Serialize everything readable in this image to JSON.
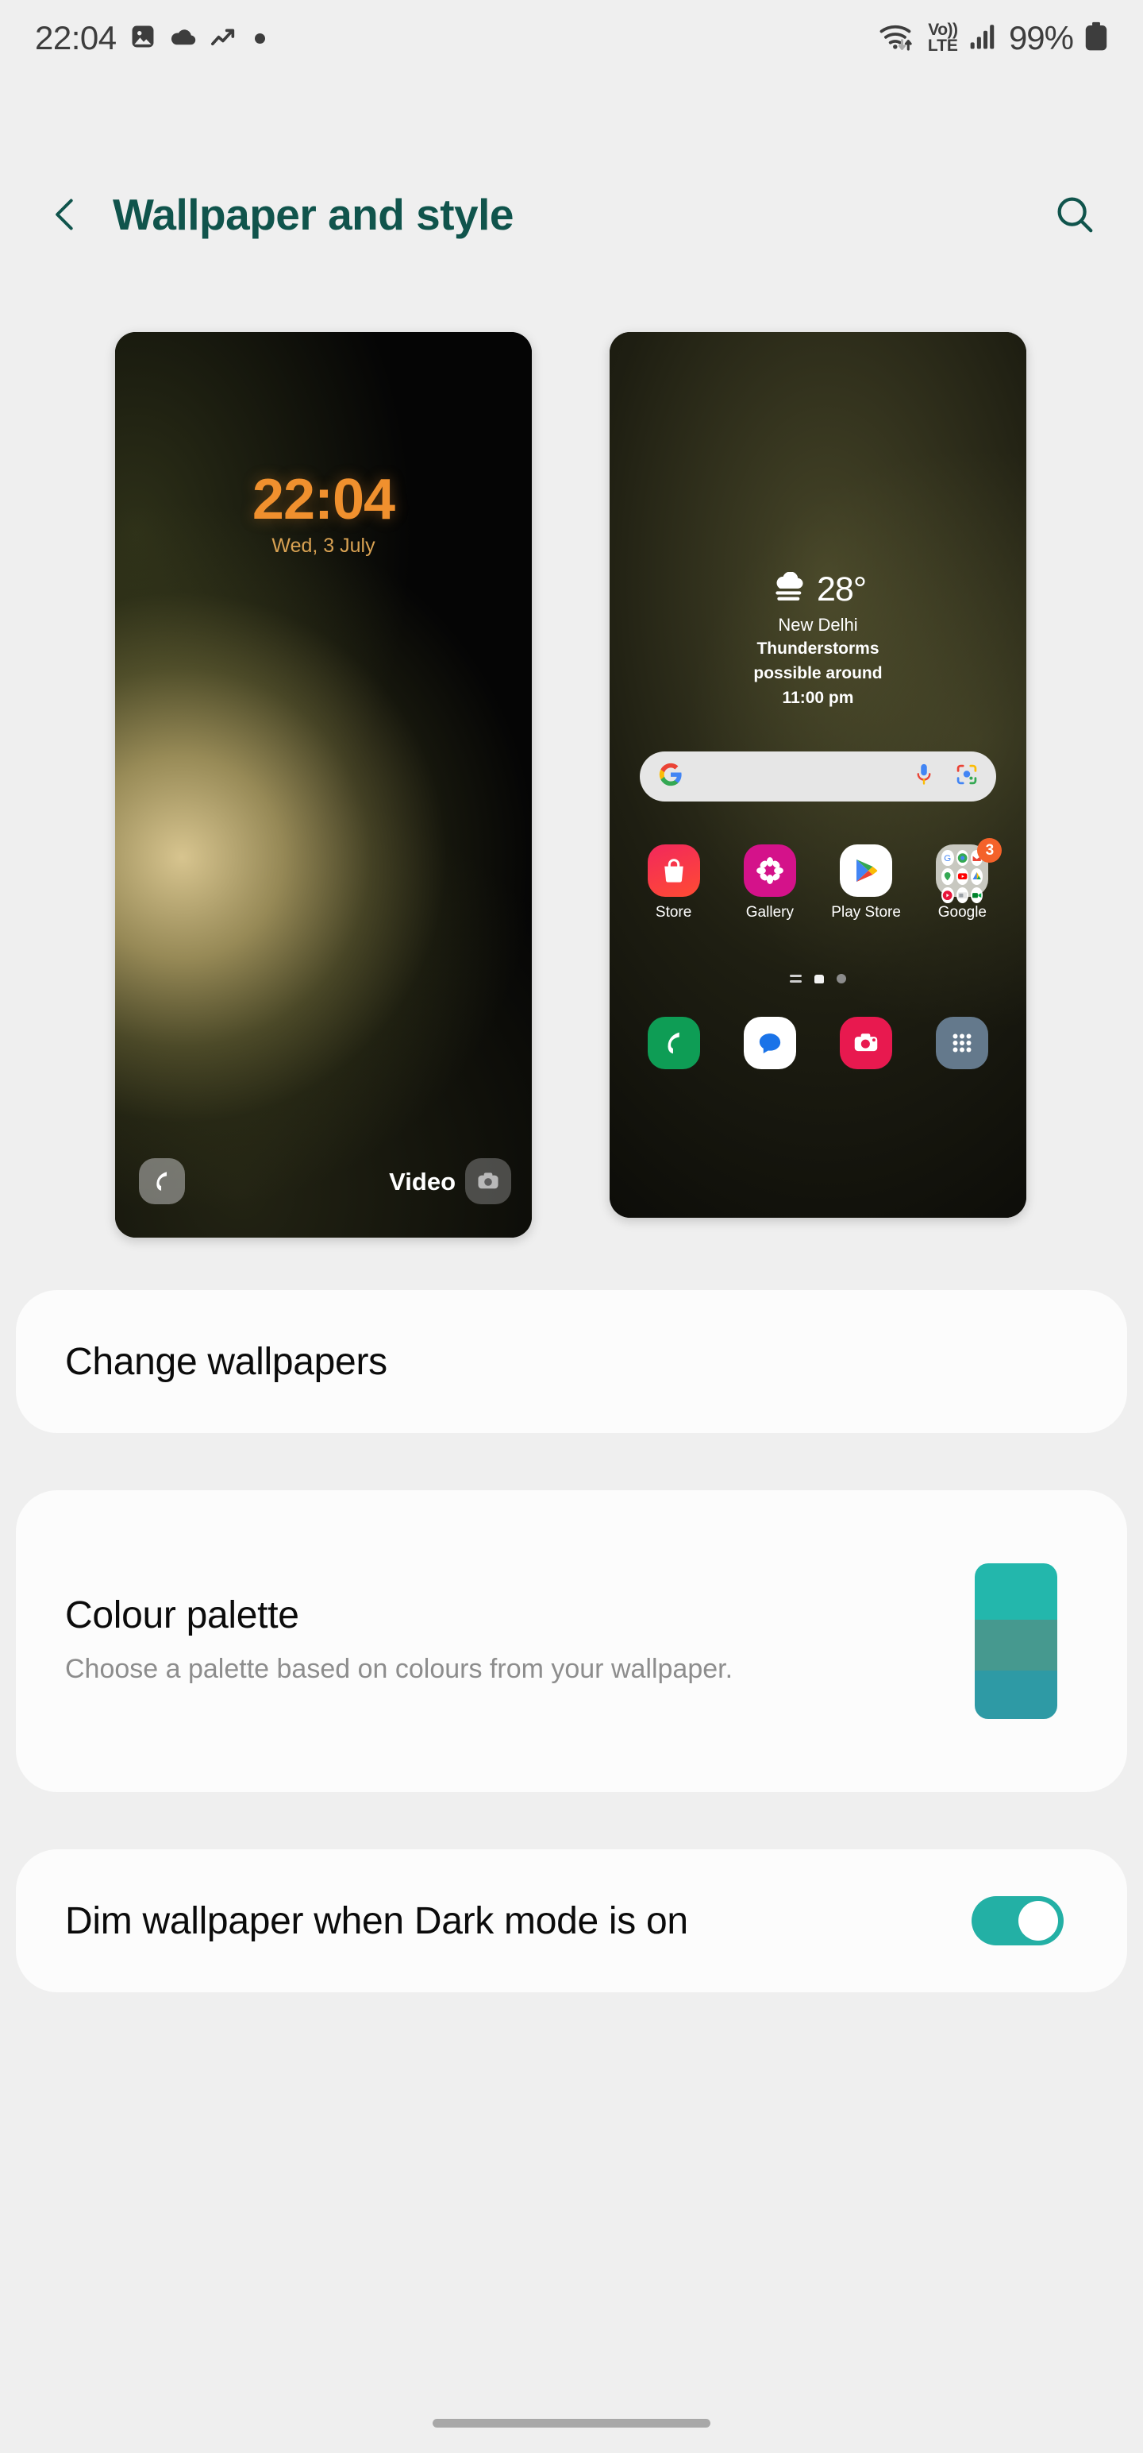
{
  "statusbar": {
    "time": "22:04",
    "icons_left": [
      "image-icon",
      "cloud-icon",
      "trending-up-icon",
      "dot-icon"
    ],
    "wifi": "wifi-icon",
    "volte_top": "Vo))",
    "volte_bottom": "LTE",
    "signal": "signal-bars-icon",
    "battery_text": "99%",
    "battery": "battery-full-icon"
  },
  "header": {
    "back": "chevron-left-icon",
    "title": "Wallpaper and style",
    "search": "search-icon"
  },
  "previews": {
    "lock": {
      "name": "lock-screen-preview",
      "clock": "22:04",
      "date": "Wed, 3 July",
      "shortcut_left": "phone-icon",
      "video_label": "Video",
      "shortcut_right": "camera-icon"
    },
    "home": {
      "name": "home-screen-preview",
      "weather": {
        "icon": "cloud-fog-icon",
        "temperature": "28°",
        "city": "New Delhi",
        "description_line1": "Thunderstorms",
        "description_line2": "possible around",
        "description_line3": "11:00 pm"
      },
      "search": {
        "logo": "google-g-icon",
        "mic": "microphone-icon",
        "lens": "google-lens-icon",
        "placeholder": ""
      },
      "apps": [
        {
          "label": "Store",
          "icon": "store-bag-icon",
          "color": "#ef3054"
        },
        {
          "label": "Gallery",
          "icon": "gallery-flower-icon",
          "color": "#d4128a"
        },
        {
          "label": "Play Store",
          "icon": "play-store-icon",
          "color": "#ffffff"
        },
        {
          "label": "Google",
          "icon": "google-folder-icon",
          "color": "#c8c8c0",
          "badge": "3"
        }
      ],
      "dock": [
        {
          "label": "Phone",
          "icon": "phone-icon",
          "color": "#0e9d55"
        },
        {
          "label": "Messages",
          "icon": "messages-icon",
          "color": "#ffffff"
        },
        {
          "label": "Camera",
          "icon": "camera-icon",
          "color": "#e8194f"
        },
        {
          "label": "Apps",
          "icon": "app-drawer-icon",
          "color": "#64798c"
        }
      ],
      "page_indicators": [
        "widgets-lines",
        "home-dot",
        "page-dot"
      ]
    }
  },
  "settings": {
    "change_wallpapers": {
      "title": "Change wallpapers"
    },
    "colour_palette": {
      "title": "Colour palette",
      "subtitle": "Choose a palette based on colours from your wallpaper.",
      "swatch_colors": [
        "#23b7ac",
        "#46998f",
        "#2e9aa5"
      ]
    },
    "dim_wallpaper": {
      "title": "Dim wallpaper when Dark mode is on",
      "toggle_state": "on",
      "toggle_color": "#23b0a5"
    }
  },
  "navbar": {
    "gesture_pill": "gesture-nav-pill"
  },
  "theme": {
    "background": "#efefef",
    "card": "#fcfcfc",
    "accent": "#10544c",
    "teal": "#23b0a5",
    "clock_orange": "#f0902e"
  }
}
